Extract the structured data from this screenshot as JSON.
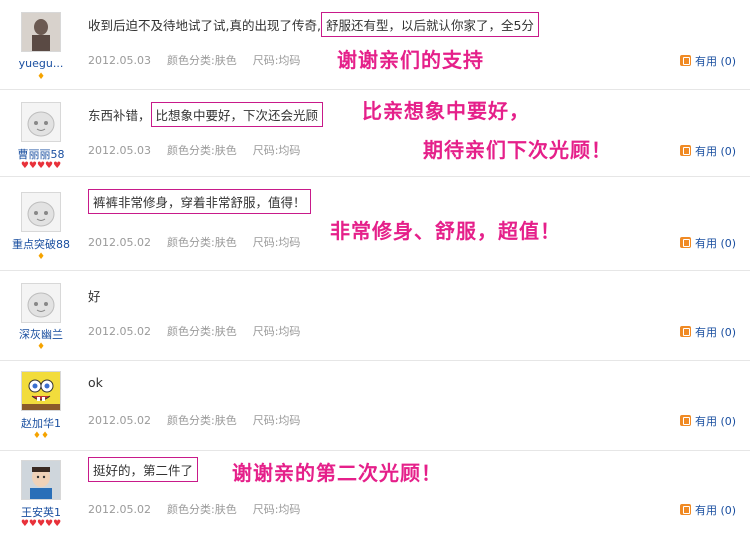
{
  "reviews": [
    {
      "username": "yuegu...",
      "text_plain": "收到后迫不及待地试了试,真的出现了传奇,",
      "text_boxed": "舒服还有型，以后就认你家了，全5分",
      "date": "2012.05.03",
      "color": "颜色分类:肤色",
      "size": "尺码:均码",
      "useful_label": "有用",
      "useful_count": "(0)",
      "badges": "♦",
      "annotations": [
        "谢谢亲们的支持"
      ]
    },
    {
      "username": "曹丽丽58",
      "text_plain": "东西补错，",
      "text_boxed": "比想象中要好，下次还会光顾",
      "date": "2012.05.03",
      "color": "颜色分类:肤色",
      "size": "尺码:均码",
      "useful_label": "有用",
      "useful_count": "(0)",
      "badges": "♥♥♥♥♥",
      "annotations": [
        "比亲想象中要好，",
        "期待亲们下次光顾！"
      ]
    },
    {
      "username": "重点突破88",
      "text_plain": "",
      "text_boxed": "裤裤非常修身，穿着非常舒服，值得！",
      "date": "2012.05.02",
      "color": "颜色分类:肤色",
      "size": "尺码:均码",
      "useful_label": "有用",
      "useful_count": "(0)",
      "badges": "♦",
      "annotations": [
        "非常修身、舒服，超值！"
      ]
    },
    {
      "username": "深灰幽兰",
      "text_plain": "好",
      "text_boxed": "",
      "date": "2012.05.02",
      "color": "颜色分类:肤色",
      "size": "尺码:均码",
      "useful_label": "有用",
      "useful_count": "(0)",
      "badges": "♦",
      "annotations": []
    },
    {
      "username": "赵加华1",
      "text_plain": "ok",
      "text_boxed": "",
      "date": "2012.05.02",
      "color": "颜色分类:肤色",
      "size": "尺码:均码",
      "useful_label": "有用",
      "useful_count": "(0)",
      "badges": "♦♦",
      "annotations": []
    },
    {
      "username": "王安英1",
      "text_plain": "",
      "text_boxed": "挺好的，第二件了",
      "date": "2012.05.02",
      "color": "颜色分类:肤色",
      "size": "尺码:均码",
      "useful_label": "有用",
      "useful_count": "(0)",
      "badges": "♥♥♥♥♥",
      "annotations": [
        "谢谢亲的第二次光顾！"
      ]
    }
  ],
  "colors": {
    "annotation": "#e5208a",
    "box_border": "#c81a8a",
    "username": "#1a4fa0",
    "meta": "#9a9a9a",
    "useful_icon": "#f08a24"
  }
}
